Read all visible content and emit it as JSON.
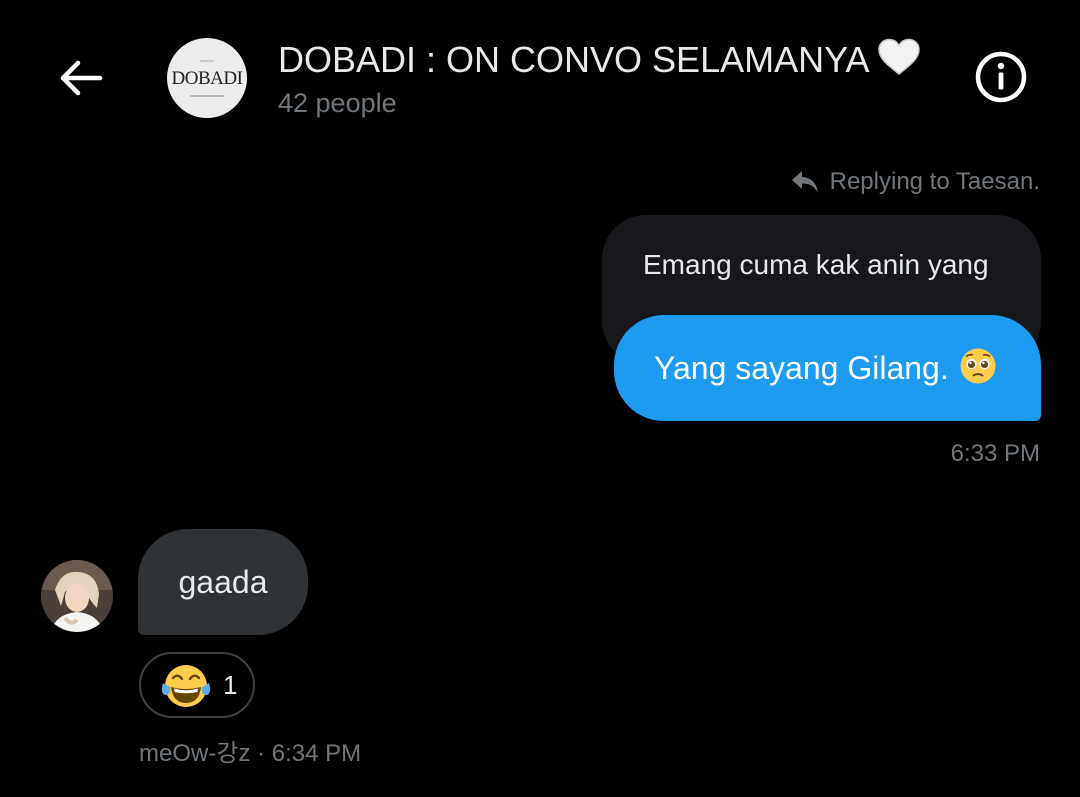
{
  "header": {
    "title": "DOBADI : ON CONVO SELAMANYA",
    "title_emoji": "white-heart-icon",
    "member_count": "42 people",
    "avatar_logo_text": "DOBADI"
  },
  "messages": {
    "outgoing": {
      "reply_label": "Replying to Taesan.",
      "quoted_text": "Emang cuma kak anin yang",
      "text": "Yang sayang Gilang.",
      "emoji": "pleading-face-icon",
      "time": "6:33 PM"
    },
    "incoming": {
      "text": "gaada",
      "reaction_emoji": "tears-of-joy-icon",
      "reaction_count": "1",
      "sender": "meOw-강z",
      "separator": " · ",
      "time": "6:34 PM"
    }
  },
  "colors": {
    "background": "#000000",
    "accent_blue": "#1d9bf0",
    "secondary_text": "#71767b",
    "incoming_bubble": "#2f3336",
    "quoted_bubble": "#16181c"
  }
}
